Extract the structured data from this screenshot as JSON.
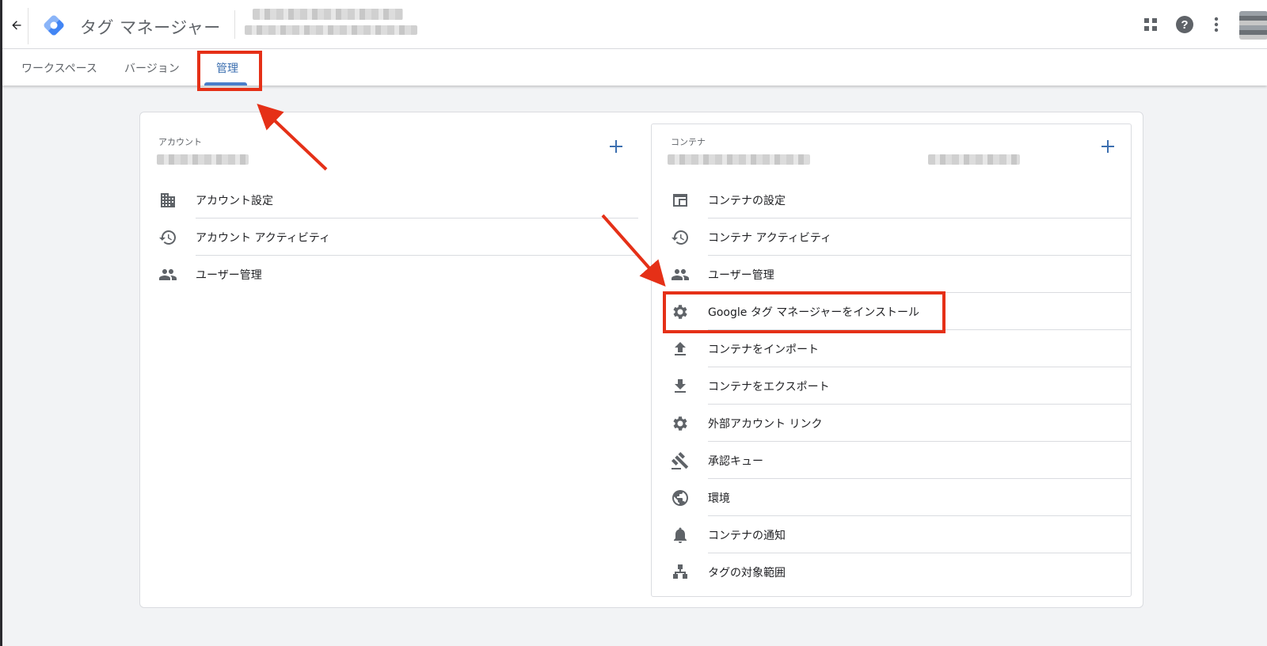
{
  "header": {
    "app_title": "タグ マネージャー",
    "icons": [
      "back-arrow-icon",
      "gtm-logo-icon",
      "apps-grid-icon",
      "help-icon",
      "more-vert-icon"
    ]
  },
  "tabs": [
    {
      "label": "ワークスペース",
      "active": false
    },
    {
      "label": "バージョン",
      "active": false
    },
    {
      "label": "管理",
      "active": true
    }
  ],
  "account": {
    "section_label": "アカウント",
    "items": [
      {
        "label": "アカウント設定",
        "icon": "building-icon"
      },
      {
        "label": "アカウント アクティビティ",
        "icon": "history-icon"
      },
      {
        "label": "ユーザー管理",
        "icon": "people-icon"
      }
    ]
  },
  "container": {
    "section_label": "コンテナ",
    "items": [
      {
        "label": "コンテナの設定",
        "icon": "web-window-icon"
      },
      {
        "label": "コンテナ アクティビティ",
        "icon": "history-icon"
      },
      {
        "label": "ユーザー管理",
        "icon": "people-icon"
      },
      {
        "label": "Google タグ マネージャーをインストール",
        "icon": "gear-icon"
      },
      {
        "label": "コンテナをインポート",
        "icon": "upload-icon"
      },
      {
        "label": "コンテナをエクスポート",
        "icon": "download-icon"
      },
      {
        "label": "外部アカウント リンク",
        "icon": "gear-icon"
      },
      {
        "label": "承認キュー",
        "icon": "gavel-icon"
      },
      {
        "label": "環境",
        "icon": "globe-icon"
      },
      {
        "label": "コンテナの通知",
        "icon": "bell-icon"
      },
      {
        "label": "タグの対象範囲",
        "icon": "hierarchy-icon"
      }
    ]
  },
  "colors": {
    "accent": "#4a7ecb",
    "annotation": "#e53017",
    "icon": "#5f6368"
  }
}
